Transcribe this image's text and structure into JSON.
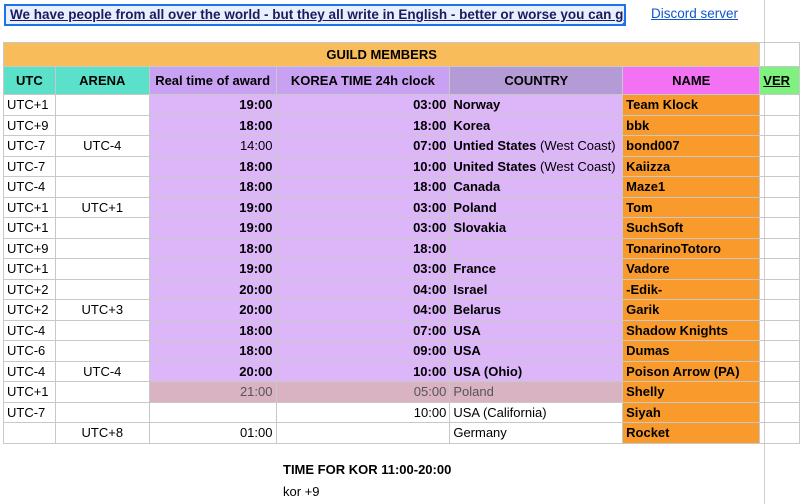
{
  "top": {
    "banner_text": "We have people from all over the world - but they all write in English - better or worse you can get al",
    "discord_link": "Discord server"
  },
  "table": {
    "title": "GUILD MEMBERS",
    "headers": {
      "utc": "UTC",
      "arena": "ARENA",
      "real_time": "Real time of award",
      "korea_time": "KOREA TIME 24h clock",
      "country": "COUNTRY",
      "name": "NAME",
      "ver": "VER"
    },
    "rows": [
      {
        "utc": "UTC+1",
        "arena": "",
        "real": "19:00",
        "korea": "03:00",
        "country": "Norway",
        "country_note": "",
        "name": "Team Klock"
      },
      {
        "utc": "UTC+9",
        "arena": "",
        "real": "18:00",
        "korea": "18:00",
        "country": "Korea",
        "country_note": "",
        "name": "bbk"
      },
      {
        "utc": "UTC-7",
        "arena": "UTC-4",
        "real": "14:00",
        "korea": "07:00",
        "country": "Untied States",
        "country_note": " (West Coast)",
        "name": "bond007"
      },
      {
        "utc": "UTC-7",
        "arena": "",
        "real": "18:00",
        "korea": "10:00",
        "country": "United States",
        "country_note": " (West Coast)",
        "name": "Kaiizza"
      },
      {
        "utc": "UTC-4",
        "arena": "",
        "real": "18:00",
        "korea": "18:00",
        "country": "Canada",
        "country_note": "",
        "name": "Maze1"
      },
      {
        "utc": "UTC+1",
        "arena": "UTC+1",
        "real": "19:00",
        "korea": "03:00",
        "country": "Poland",
        "country_note": "",
        "name": "Tom"
      },
      {
        "utc": "UTC+1",
        "arena": "",
        "real": "19:00",
        "korea": "03:00",
        "country": "Slovakia",
        "country_note": "",
        "name": "SuchSoft"
      },
      {
        "utc": "UTC+9",
        "arena": "",
        "real": "18:00",
        "korea": "18:00",
        "country": "",
        "country_note": "",
        "name": "TonarinoTotoro"
      },
      {
        "utc": "UTC+1",
        "arena": "",
        "real": "19:00",
        "korea": "03:00",
        "country": "France",
        "country_note": "",
        "name": "Vadore"
      },
      {
        "utc": "UTC+2",
        "arena": "",
        "real": "20:00",
        "korea": "04:00",
        "country": "Israel",
        "country_note": "",
        "name": "-Edik-"
      },
      {
        "utc": "UTC+2",
        "arena": "UTC+3",
        "real": "20:00",
        "korea": "04:00",
        "country": "Belarus",
        "country_note": "",
        "name": "Garik"
      },
      {
        "utc": "UTC-4",
        "arena": "",
        "real": "18:00",
        "korea": "07:00",
        "country": "USA",
        "country_note": "",
        "name": "Shadow Knights"
      },
      {
        "utc": "UTC-6",
        "arena": "",
        "real": "18:00",
        "korea": "09:00",
        "country": "USA",
        "country_note": "",
        "name": "Dumas"
      },
      {
        "utc": "UTC-4",
        "arena": "UTC-4",
        "real": "20:00",
        "korea": "10:00",
        "country": "USA (Ohio)",
        "country_note": "",
        "name": "Poison Arrow (PA)"
      },
      {
        "utc": "UTC+1",
        "arena": "",
        "real": "21:00",
        "korea": "05:00",
        "country": "Poland",
        "country_note": "",
        "name": "Shelly"
      },
      {
        "utc": "UTC-7",
        "arena": "",
        "real": "",
        "korea": "10:00",
        "country": "USA (California)",
        "country_note": "",
        "name": "Siyah"
      },
      {
        "utc": "",
        "arena": "UTC+8",
        "real": "01:00",
        "korea": "",
        "country": "Germany",
        "country_note": "",
        "name": "Rocket"
      }
    ]
  },
  "notes": {
    "time_for_kor": "TIME FOR KOR 11:00-20:00",
    "kor_offset": "kor +9"
  },
  "colors": {
    "banner_orange": "#f9bc5a",
    "teal": "#5be0c9",
    "lilac": "#dcb6f8",
    "rose": "#d9b3c1",
    "name_orange": "#f99a2d",
    "pink": "#f371f3",
    "green": "#7ef17e"
  }
}
